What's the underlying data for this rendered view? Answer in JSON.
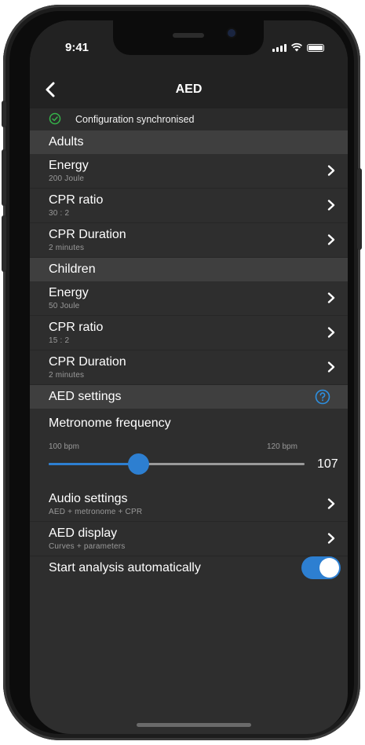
{
  "status_bar": {
    "time": "9:41"
  },
  "nav": {
    "title": "AED",
    "back_icon": "chevron-left-icon"
  },
  "sync": {
    "text": "Configuration synchronised",
    "icon": "check-circle-icon",
    "icon_color": "#35b34a"
  },
  "sections": {
    "adults": {
      "label": "Adults",
      "rows": [
        {
          "title": "Energy",
          "subtitle": "200 Joule"
        },
        {
          "title": "CPR ratio",
          "subtitle": "30 : 2"
        },
        {
          "title": "CPR Duration",
          "subtitle": "2 minutes"
        }
      ]
    },
    "children": {
      "label": "Children",
      "rows": [
        {
          "title": "Energy",
          "subtitle": "50 Joule"
        },
        {
          "title": "CPR ratio",
          "subtitle": "15 : 2"
        },
        {
          "title": "CPR Duration",
          "subtitle": "2 minutes"
        }
      ]
    },
    "aed_settings": {
      "label": "AED settings",
      "help_icon": "help-circle-icon",
      "metronome": {
        "title": "Metronome frequency",
        "min_label": "100 bpm",
        "max_label": "120 bpm",
        "min": 100,
        "max": 120,
        "value": 107,
        "value_label": "107"
      },
      "rows": [
        {
          "title": "Audio settings",
          "subtitle": "AED + metronome + CPR"
        },
        {
          "title": "AED display",
          "subtitle": "Curves + parameters"
        }
      ],
      "auto_analysis": {
        "title": "Start analysis automatically",
        "enabled": true
      }
    }
  },
  "colors": {
    "accent": "#2d7fd1",
    "success": "#35b34a",
    "background": "#2e2e2e",
    "section": "#3f3f3f"
  }
}
